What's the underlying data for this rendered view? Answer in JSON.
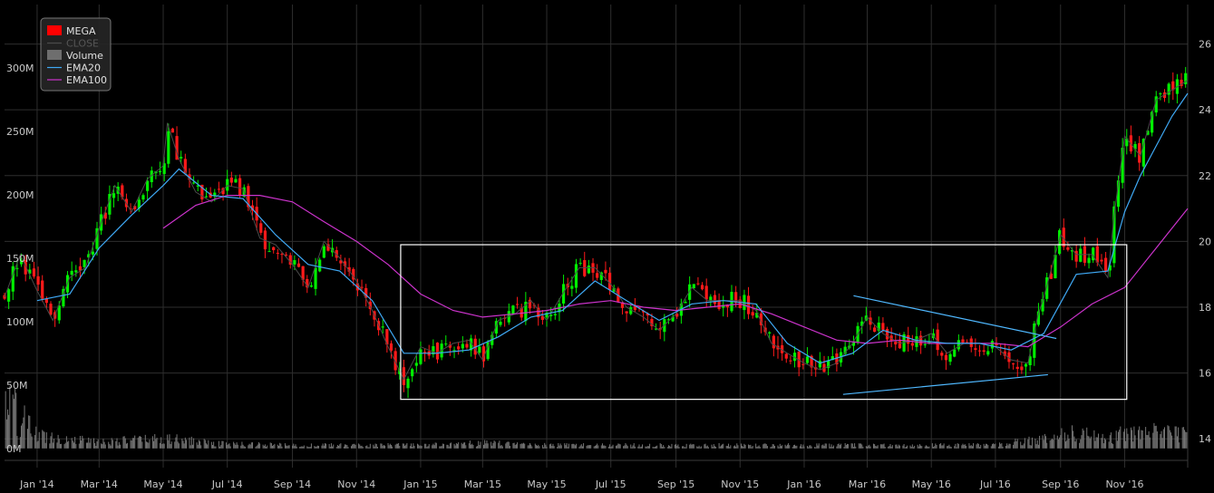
{
  "chart_data": {
    "type": "candlestick",
    "symbol": "MEGA",
    "legend": {
      "placement": "top-left",
      "entries": [
        {
          "label": "MEGA",
          "color": "#ff0000",
          "kind": "box"
        },
        {
          "label": "CLOSE",
          "color": "#4a4a4a",
          "kind": "line"
        },
        {
          "label": "Volume",
          "color": "#6e6e6e",
          "kind": "box"
        },
        {
          "label": "EMA20",
          "color": "#3fa9f5",
          "kind": "line"
        },
        {
          "label": "EMA100",
          "color": "#cc33cc",
          "kind": "line"
        }
      ]
    },
    "colors": {
      "up": "#00ee00",
      "down": "#ff1a1a",
      "ema20": "#3fa9f5",
      "ema100": "#cc33cc",
      "grid": "#2e2e2e",
      "background": "#000000",
      "rectangle": "#ffffff",
      "trendline": "#4fb8ff",
      "volume": "#777777"
    },
    "grid": true,
    "x_axis": {
      "ticks": [
        "Jan '14",
        "Mar '14",
        "May '14",
        "Jul '14",
        "Sep '14",
        "Nov '14",
        "Jan '15",
        "Mar '15",
        "May '15",
        "Jul '15",
        "Sep '15",
        "Nov '15",
        "Jan '16",
        "Mar '16",
        "May '16",
        "Jul '16",
        "Sep '16",
        "Nov '16"
      ],
      "range": [
        "2013-12-01",
        "2016-12-31"
      ]
    },
    "y_axis_price": {
      "side": "right",
      "ticks": [
        14,
        16,
        18,
        20,
        22,
        24,
        26
      ],
      "range": [
        13.4,
        27.2
      ]
    },
    "y_axis_volume": {
      "side": "left",
      "ticks": [
        "0M",
        "50M",
        "100M",
        "150M",
        "200M",
        "250M",
        "300M"
      ],
      "values": [
        0,
        50,
        100,
        150,
        200,
        250,
        300
      ],
      "range": [
        -8,
        350
      ]
    },
    "close_path": [
      [
        "2013-12-01",
        18.3
      ],
      [
        "2013-12-16",
        19.6
      ],
      [
        "2014-01-01",
        18.5
      ],
      [
        "2014-01-16",
        17.6
      ],
      [
        "2014-02-01",
        18.9
      ],
      [
        "2014-02-16",
        19.2
      ],
      [
        "2014-03-01",
        20.4
      ],
      [
        "2014-03-16",
        21.7
      ],
      [
        "2014-04-01",
        20.9
      ],
      [
        "2014-04-16",
        21.9
      ],
      [
        "2014-05-01",
        22.3
      ],
      [
        "2014-05-05",
        23.6
      ],
      [
        "2014-05-16",
        22.5
      ],
      [
        "2014-06-01",
        21.5
      ],
      [
        "2014-06-16",
        21.2
      ],
      [
        "2014-07-01",
        21.7
      ],
      [
        "2014-07-16",
        21.6
      ],
      [
        "2014-08-01",
        20.1
      ],
      [
        "2014-08-16",
        19.9
      ],
      [
        "2014-09-01",
        19.3
      ],
      [
        "2014-09-16",
        18.6
      ],
      [
        "2014-10-01",
        20.0
      ],
      [
        "2014-10-16",
        19.5
      ],
      [
        "2014-11-01",
        18.8
      ],
      [
        "2014-11-16",
        17.9
      ],
      [
        "2014-12-01",
        16.8
      ],
      [
        "2014-12-16",
        15.8
      ],
      [
        "2015-01-01",
        16.8
      ],
      [
        "2015-01-16",
        16.6
      ],
      [
        "2015-02-01",
        16.9
      ],
      [
        "2015-02-16",
        17.0
      ],
      [
        "2015-03-01",
        16.4
      ],
      [
        "2015-03-16",
        17.6
      ],
      [
        "2015-04-01",
        17.8
      ],
      [
        "2015-04-16",
        18.2
      ],
      [
        "2015-05-01",
        17.6
      ],
      [
        "2015-05-16",
        18.4
      ],
      [
        "2015-06-01",
        19.2
      ],
      [
        "2015-06-16",
        19.2
      ],
      [
        "2015-07-01",
        18.7
      ],
      [
        "2015-07-16",
        18.0
      ],
      [
        "2015-08-01",
        17.7
      ],
      [
        "2015-08-16",
        17.3
      ],
      [
        "2015-09-01",
        17.8
      ],
      [
        "2015-09-16",
        18.6
      ],
      [
        "2015-10-01",
        18.2
      ],
      [
        "2015-10-16",
        18.2
      ],
      [
        "2015-11-01",
        18.2
      ],
      [
        "2015-11-16",
        17.9
      ],
      [
        "2015-12-01",
        16.9
      ],
      [
        "2015-12-16",
        16.6
      ],
      [
        "2016-01-01",
        16.3
      ],
      [
        "2016-01-16",
        16.1
      ],
      [
        "2016-02-01",
        16.3
      ],
      [
        "2016-02-16",
        16.9
      ],
      [
        "2016-03-01",
        17.7
      ],
      [
        "2016-03-16",
        17.2
      ],
      [
        "2016-04-01",
        16.9
      ],
      [
        "2016-04-16",
        17.0
      ],
      [
        "2016-05-01",
        17.2
      ],
      [
        "2016-05-16",
        16.6
      ],
      [
        "2016-06-01",
        16.9
      ],
      [
        "2016-06-16",
        16.9
      ],
      [
        "2016-07-01",
        16.8
      ],
      [
        "2016-07-16",
        16.4
      ],
      [
        "2016-08-01",
        16.3
      ],
      [
        "2016-08-10",
        17.7
      ],
      [
        "2016-08-16",
        18.3
      ],
      [
        "2016-09-01",
        20.2
      ],
      [
        "2016-09-16",
        19.6
      ],
      [
        "2016-10-01",
        19.6
      ],
      [
        "2016-10-16",
        18.9
      ],
      [
        "2016-10-22",
        20.8
      ],
      [
        "2016-11-01",
        23.2
      ],
      [
        "2016-11-16",
        22.6
      ],
      [
        "2016-12-01",
        24.3
      ],
      [
        "2016-12-16",
        24.6
      ],
      [
        "2016-12-31",
        24.9
      ]
    ],
    "ema20_path": [
      [
        "2014-01-01",
        18.2
      ],
      [
        "2014-02-01",
        18.4
      ],
      [
        "2014-03-01",
        19.8
      ],
      [
        "2014-04-01",
        20.8
      ],
      [
        "2014-05-01",
        21.7
      ],
      [
        "2014-05-16",
        22.2
      ],
      [
        "2014-06-16",
        21.4
      ],
      [
        "2014-07-16",
        21.3
      ],
      [
        "2014-08-16",
        20.2
      ],
      [
        "2014-09-16",
        19.3
      ],
      [
        "2014-10-16",
        19.1
      ],
      [
        "2014-11-16",
        18.2
      ],
      [
        "2014-12-16",
        16.6
      ],
      [
        "2015-01-16",
        16.6
      ],
      [
        "2015-02-16",
        16.7
      ],
      [
        "2015-03-16",
        17.1
      ],
      [
        "2015-04-16",
        17.7
      ],
      [
        "2015-05-16",
        17.9
      ],
      [
        "2015-06-16",
        18.8
      ],
      [
        "2015-07-16",
        18.2
      ],
      [
        "2015-08-16",
        17.6
      ],
      [
        "2015-09-16",
        18.1
      ],
      [
        "2015-10-16",
        18.2
      ],
      [
        "2015-11-16",
        18.1
      ],
      [
        "2015-12-16",
        16.9
      ],
      [
        "2016-01-16",
        16.3
      ],
      [
        "2016-02-16",
        16.6
      ],
      [
        "2016-03-16",
        17.3
      ],
      [
        "2016-04-16",
        17.0
      ],
      [
        "2016-05-16",
        16.9
      ],
      [
        "2016-06-16",
        16.9
      ],
      [
        "2016-07-16",
        16.7
      ],
      [
        "2016-08-16",
        17.2
      ],
      [
        "2016-09-16",
        19.0
      ],
      [
        "2016-10-16",
        19.1
      ],
      [
        "2016-11-01",
        20.9
      ],
      [
        "2016-11-16",
        22.0
      ],
      [
        "2016-12-16",
        23.8
      ],
      [
        "2016-12-31",
        24.5
      ]
    ],
    "ema100_path": [
      [
        "2014-05-01",
        20.4
      ],
      [
        "2014-06-01",
        21.1
      ],
      [
        "2014-07-01",
        21.4
      ],
      [
        "2014-08-01",
        21.4
      ],
      [
        "2014-09-01",
        21.2
      ],
      [
        "2014-10-01",
        20.6
      ],
      [
        "2014-11-01",
        20.0
      ],
      [
        "2014-12-01",
        19.3
      ],
      [
        "2015-01-01",
        18.4
      ],
      [
        "2015-02-01",
        17.9
      ],
      [
        "2015-03-01",
        17.7
      ],
      [
        "2015-04-01",
        17.8
      ],
      [
        "2015-05-01",
        17.9
      ],
      [
        "2015-06-01",
        18.1
      ],
      [
        "2015-07-01",
        18.2
      ],
      [
        "2015-08-01",
        18.0
      ],
      [
        "2015-09-01",
        17.9
      ],
      [
        "2015-10-01",
        18.0
      ],
      [
        "2015-11-01",
        18.1
      ],
      [
        "2015-12-01",
        17.8
      ],
      [
        "2016-01-01",
        17.4
      ],
      [
        "2016-02-01",
        17.0
      ],
      [
        "2016-03-01",
        16.9
      ],
      [
        "2016-04-01",
        17.0
      ],
      [
        "2016-05-01",
        16.9
      ],
      [
        "2016-06-01",
        16.9
      ],
      [
        "2016-07-01",
        16.9
      ],
      [
        "2016-08-01",
        16.8
      ],
      [
        "2016-09-01",
        17.4
      ],
      [
        "2016-10-01",
        18.1
      ],
      [
        "2016-11-01",
        18.6
      ],
      [
        "2016-12-01",
        19.8
      ],
      [
        "2016-12-31",
        21.0
      ]
    ],
    "volume_profile": [
      [
        "2013-12-01",
        45
      ],
      [
        "2014-01-01",
        12
      ],
      [
        "2014-03-01",
        6
      ],
      [
        "2014-05-01",
        9
      ],
      [
        "2014-07-01",
        4
      ],
      [
        "2014-09-01",
        3
      ],
      [
        "2014-11-01",
        3
      ],
      [
        "2015-01-01",
        3
      ],
      [
        "2015-03-01",
        5
      ],
      [
        "2015-05-01",
        3
      ],
      [
        "2015-07-01",
        3
      ],
      [
        "2015-09-01",
        3
      ],
      [
        "2015-11-01",
        3
      ],
      [
        "2016-01-01",
        3
      ],
      [
        "2016-03-01",
        3
      ],
      [
        "2016-05-01",
        3
      ],
      [
        "2016-07-01",
        3
      ],
      [
        "2016-08-20",
        10
      ],
      [
        "2016-09-15",
        14
      ],
      [
        "2016-10-15",
        10
      ],
      [
        "2016-11-15",
        16
      ],
      [
        "2016-12-31",
        12
      ]
    ],
    "rectangle": {
      "x1": "2014-12-13",
      "x2": "2016-11-03",
      "y1": 15.2,
      "y2": 19.9
    },
    "trendlines": [
      {
        "x1": "2016-02-17",
        "y1": 18.35,
        "x2": "2016-08-28",
        "y2": 17.05
      },
      {
        "x1": "2016-02-07",
        "y1": 15.35,
        "x2": "2016-08-20",
        "y2": 15.95
      }
    ]
  }
}
